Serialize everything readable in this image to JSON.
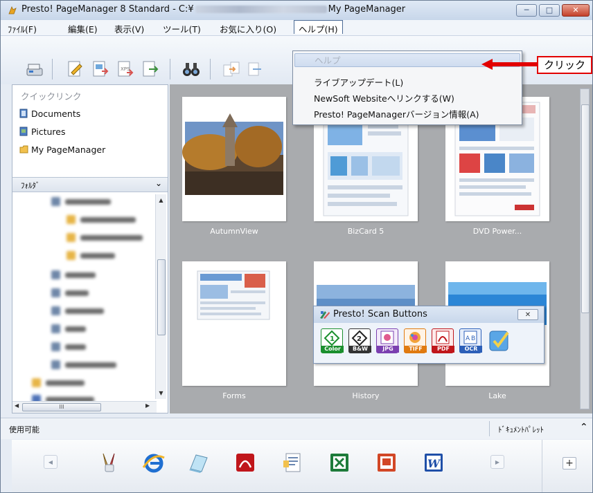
{
  "window": {
    "title_prefix": "Presto! PageManager 8 Standard - C:¥",
    "title_suffix": "My PageManager",
    "buttons": {
      "minimize": "─",
      "maximize": "□",
      "close": "✕"
    }
  },
  "menubar": {
    "items": [
      "ﾌｧｲﾙ(F)",
      "編集(E)",
      "表示(V)",
      "ツール(T)",
      "お気に入り(O)",
      "ヘルプ(H)"
    ]
  },
  "help_menu": {
    "items": [
      {
        "label": "ヘルプ",
        "enabled": false
      },
      {
        "label": "ライブアップデート(L)"
      },
      {
        "label": "NewSoft Websiteへリンクする(W)"
      },
      {
        "label": "Presto! PageManagerバージョン情報(A)"
      }
    ]
  },
  "annotation": {
    "label": "クリック",
    "color": "#e20000"
  },
  "left_pane": {
    "quicklink_header": "クイックリンク",
    "quicklinks": [
      "Documents",
      "Pictures",
      "My PageManager"
    ],
    "folder_header": "ﾌｫﾙﾀﾞ",
    "hscroll_thumb": "III"
  },
  "thumbnails": [
    {
      "label": "AutumnView"
    },
    {
      "label": "BizCard 5"
    },
    {
      "label": "DVD Power..."
    },
    {
      "label": "Forms"
    },
    {
      "label": "History"
    },
    {
      "label": "Lake"
    }
  ],
  "scan_buttons": {
    "title": "Presto! Scan Buttons",
    "close": "✕",
    "buttons": [
      {
        "name": "color",
        "label": "Color",
        "color": "#1b8f2e"
      },
      {
        "name": "bw",
        "label": "B&W",
        "color": "#333333"
      },
      {
        "name": "jpg",
        "label": "JPG",
        "color": "#7b3fb0"
      },
      {
        "name": "tiff",
        "label": "TIFF",
        "color": "#e07a10"
      },
      {
        "name": "pdf",
        "label": "PDF",
        "color": "#c0161b"
      },
      {
        "name": "ocr",
        "label": "OCR",
        "color": "#2c5fb8"
      },
      {
        "name": "custom",
        "label": "",
        "color": "#3a8fd8"
      }
    ]
  },
  "status": {
    "left": "使用可能",
    "right": "ﾄﾞｷｭﾒﾝﾄﾊﾟﾚｯﾄ",
    "collapse": "⌃"
  },
  "dock": {
    "apps": [
      "paint-tools",
      "internet-explorer",
      "notepad",
      "acrobat",
      "wordpad",
      "excel",
      "powerpoint",
      "word"
    ],
    "add": "+"
  }
}
